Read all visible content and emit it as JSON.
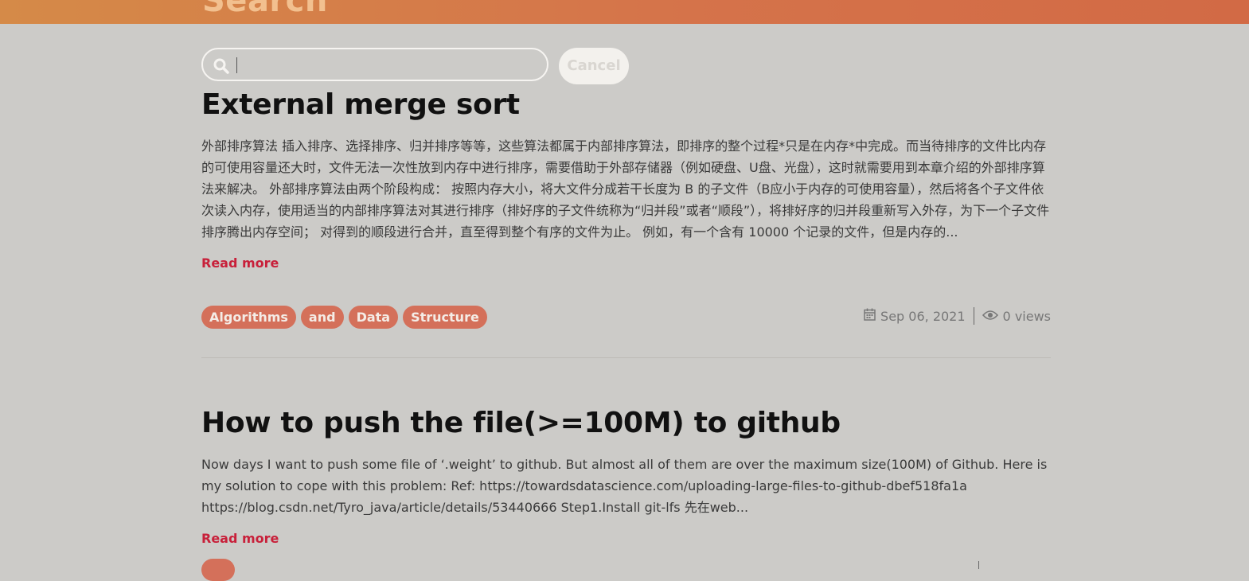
{
  "header": {
    "title": "Search",
    "gradient_start": "#d58a48",
    "gradient_end": "#d26a45"
  },
  "search": {
    "placeholder": "",
    "value": "",
    "icon": "search-icon",
    "cancel_label": "Cancel"
  },
  "posts": [
    {
      "title": "External merge sort",
      "excerpt": "外部排序算法 插入排序、选择排序、归并排序等等，这些算法都属于内部排序算法，即排序的整个过程*只是在内存*中完成。而当待排序的文件比内存的可使用容量还大时，文件无法一次性放到内存中进行排序，需要借助于外部存储器（例如硬盘、U盘、光盘），这时就需要用到本章介绍的外部排序算法来解决。 外部排序算法由两个阶段构成： 按照内存大小，将大文件分成若干长度为 B 的子文件（B应小于内存的可使用容量），然后将各个子文件依次读入内存，使用适当的内部排序算法对其进行排序（排好序的子文件统称为“归并段”或者“顺段”），将排好序的归并段重新写入外存，为下一个子文件排序腾出内存空间； 对得到的顺段进行合并，直至得到整个有序的文件为止。 例如，有一个含有 10000 个记录的文件，但是内存的...",
      "read_more": "Read more",
      "tags": [
        "Algorithms",
        "and",
        "Data",
        "Structure"
      ],
      "date": "Sep 06, 2021",
      "views": "0 views"
    },
    {
      "title": "How to push the file(>=100M) to github",
      "excerpt": "Now days I want to push some file of ‘.weight’ to github. But almost all of them are over the maximum size(100M) of Github. Here is my solution to cope with this problem: Ref:   https://towardsdatascience.com/uploading-large-files-to-github-dbef518fa1a https://blog.csdn.net/Tyro_java/article/details/53440666 Step1.Install git-lfs 先在web...",
      "read_more": "Read more"
    }
  ],
  "colors": {
    "background": "#cccbc8",
    "tag_bg": "#d4705a",
    "link": "#c8203a"
  }
}
